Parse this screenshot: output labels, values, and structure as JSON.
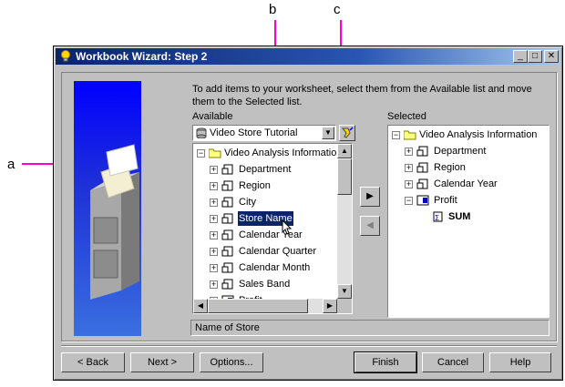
{
  "callouts": {
    "a": "a",
    "b": "b",
    "c": "c"
  },
  "window": {
    "title": "Workbook Wizard: Step 2",
    "controls": {
      "minimize": "_",
      "maximize": "□",
      "close": "✕"
    }
  },
  "instructions": "To add items to your worksheet, select them from the Available list and move them to the Selected list.",
  "available": {
    "label": "Available",
    "combo_value": "Video Store Tutorial",
    "root": "Video Analysis Information",
    "items": [
      "Department",
      "Region",
      "City",
      "Store Name",
      "Calendar Year",
      "Calendar Quarter",
      "Calendar Month",
      "Sales Band",
      "Profit"
    ],
    "selected_item": "Store Name"
  },
  "selected": {
    "label": "Selected",
    "root": "Video Analysis Information",
    "items": [
      "Department",
      "Region",
      "Calendar Year",
      "Profit"
    ],
    "child": "SUM"
  },
  "status_text": "Name of Store",
  "buttons": {
    "back": "< Back",
    "next": "Next >",
    "options": "Options...",
    "finish": "Finish",
    "cancel": "Cancel",
    "help": "Help"
  },
  "icons": {
    "app": "lightbulb-icon",
    "folder": "folder-icon",
    "item": "folder-item-icon",
    "measure": "grid-measure-icon",
    "sum": "sigma-icon",
    "database": "database-icon",
    "find": "flashlight-icon"
  },
  "colors": {
    "titlebar": "#0a246a",
    "callout": "#ff00cc",
    "graphic": "#0000ff",
    "selection": "#0a246a"
  }
}
